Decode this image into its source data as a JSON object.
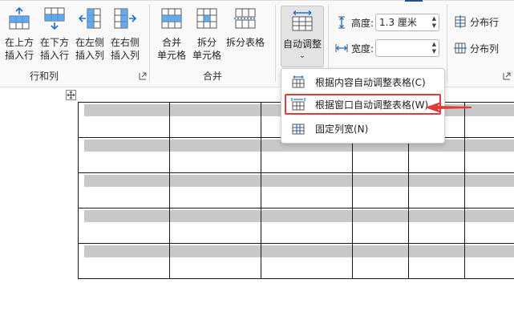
{
  "ribbon": {
    "rows_cols_group": {
      "label": "行和列",
      "buttons": [
        {
          "id": "insert-above",
          "label": "在上方\n插入行"
        },
        {
          "id": "insert-below",
          "label": "在下方\n插入行"
        },
        {
          "id": "insert-left",
          "label": "在左侧\n插入列"
        },
        {
          "id": "insert-right",
          "label": "在右侧\n插入列"
        }
      ]
    },
    "merge_group": {
      "label": "合并",
      "buttons": [
        {
          "id": "merge-cells",
          "label": "合并\n单元格"
        },
        {
          "id": "split-cells",
          "label": "拆分\n单元格"
        },
        {
          "id": "split-table",
          "label": "拆分表格"
        }
      ]
    },
    "autofit": {
      "label": "自动调整",
      "chevron": "⌄"
    },
    "height": {
      "label": "高度:",
      "value": "1.3 厘米"
    },
    "width": {
      "label": "宽度:",
      "value": ""
    },
    "distribute_rows": "分布行",
    "distribute_cols": "分布列"
  },
  "autofit_menu": {
    "items": [
      {
        "label": "根据内容自动调整表格(C)",
        "highlighted": false
      },
      {
        "label": "根据窗口自动调整表格(W)",
        "highlighted": true
      },
      {
        "label": "固定列宽(N)",
        "highlighted": false
      }
    ]
  },
  "colors": {
    "accent_blue": "#1f6fd1",
    "highlight_red": "#e23a3a",
    "ribbon_bg": "#f9f9f9",
    "cell_shade": "#c8c8c8"
  }
}
